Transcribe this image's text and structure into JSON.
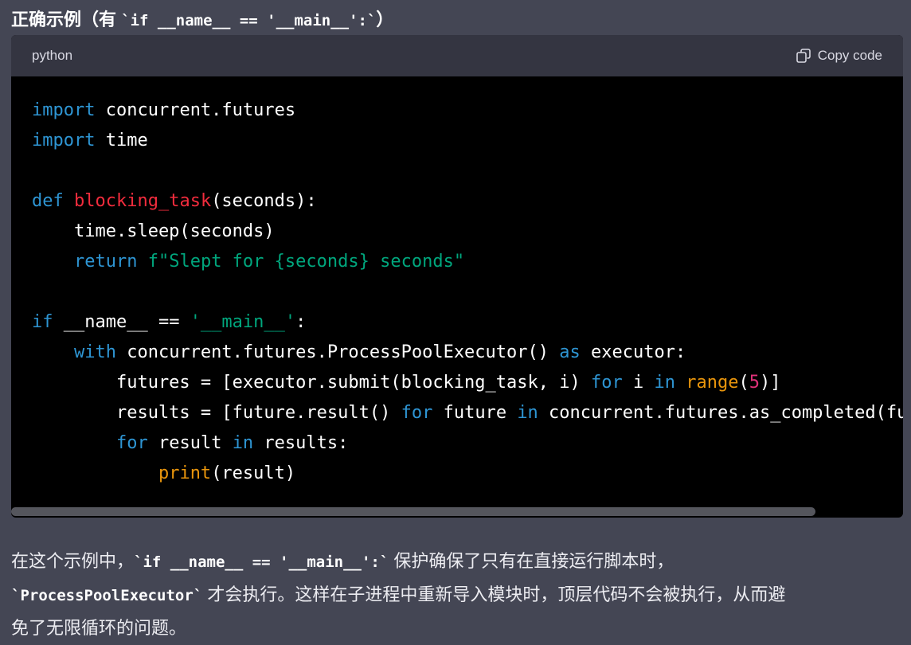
{
  "colors": {
    "background": "#444654",
    "text": "#ececf1",
    "code_header": "#343541",
    "code_body": "#000000",
    "keyword": "#2e95d3",
    "function_name": "#f22c3d",
    "string": "#00a67d",
    "builtin": "#e9950c",
    "number": "#df3079",
    "scrollbar_thumb": "#55565d"
  },
  "title": {
    "prefix": "正确示例（有 ",
    "code": "`if __name__ == '__main__':`",
    "suffix": "）"
  },
  "code_block": {
    "language": "python",
    "copy_label": "Copy code",
    "copy_icon": "copy-icon",
    "lines": [
      [
        {
          "t": "import",
          "k": "kw"
        },
        {
          "t": " concurrent.futures"
        }
      ],
      [
        {
          "t": "import",
          "k": "kw"
        },
        {
          "t": " time"
        }
      ],
      [],
      [
        {
          "t": "def",
          "k": "kw"
        },
        {
          "t": " "
        },
        {
          "t": "blocking_task",
          "k": "fn"
        },
        {
          "t": "(seconds):"
        }
      ],
      [
        {
          "t": "    time.sleep(seconds)"
        }
      ],
      [
        {
          "t": "    "
        },
        {
          "t": "return",
          "k": "kw"
        },
        {
          "t": " "
        },
        {
          "t": "f\"Slept for {seconds} seconds\"",
          "k": "str"
        }
      ],
      [],
      [
        {
          "t": "if",
          "k": "kw"
        },
        {
          "t": " __name__ == "
        },
        {
          "t": "'__main__'",
          "k": "str"
        },
        {
          "t": ":"
        }
      ],
      [
        {
          "t": "    "
        },
        {
          "t": "with",
          "k": "kw"
        },
        {
          "t": " concurrent.futures.ProcessPoolExecutor() "
        },
        {
          "t": "as",
          "k": "kw"
        },
        {
          "t": " executor:"
        }
      ],
      [
        {
          "t": "        futures = [executor.submit(blocking_task, i) "
        },
        {
          "t": "for",
          "k": "kw"
        },
        {
          "t": " i "
        },
        {
          "t": "in",
          "k": "kw"
        },
        {
          "t": " "
        },
        {
          "t": "range",
          "k": "bi"
        },
        {
          "t": "("
        },
        {
          "t": "5",
          "k": "num"
        },
        {
          "t": ")]"
        }
      ],
      [
        {
          "t": "        results = [future.result() "
        },
        {
          "t": "for",
          "k": "kw"
        },
        {
          "t": " future "
        },
        {
          "t": "in",
          "k": "kw"
        },
        {
          "t": " concurrent.futures.as_completed(fu"
        }
      ],
      [
        {
          "t": "        "
        },
        {
          "t": "for",
          "k": "kw"
        },
        {
          "t": " result "
        },
        {
          "t": "in",
          "k": "kw"
        },
        {
          "t": " results:"
        }
      ],
      [
        {
          "t": "            "
        },
        {
          "t": "print",
          "k": "bi"
        },
        {
          "t": "(result)"
        }
      ]
    ]
  },
  "paragraph": {
    "line1_text_a": "在这个示例中，",
    "line1_code": "`if __name__ == '__main__':`",
    "line1_text_b": " 保护确保了只有在直接运行脚本时，",
    "line2_code": "`ProcessPoolExecutor`",
    "line2_text": " 才会执行。这样在子进程中重新导入模块时，顶层代码不会被执行，从而避",
    "line3_text": "免了无限循环的问题。"
  }
}
